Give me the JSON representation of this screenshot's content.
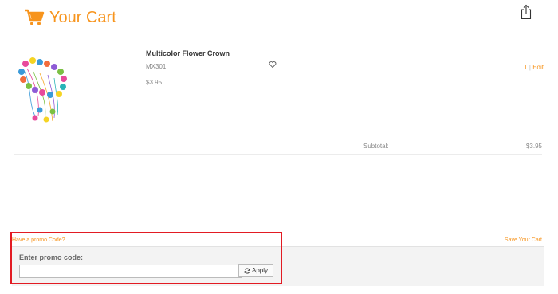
{
  "header": {
    "title": "Your Cart",
    "cart_icon": "shopping-cart-icon",
    "share_icon": "share-icon",
    "accent_color": "#f7941d"
  },
  "cart": {
    "items": [
      {
        "name": "Multicolor Flower Crown",
        "sku": "MX301",
        "price": "$3.95",
        "quantity": "1",
        "edit_label": "Edit",
        "wish_icon": "heart-icon"
      }
    ],
    "subtotal_label": "Subtotal:",
    "subtotal_value": "$3.95"
  },
  "promo": {
    "link_label": "Have a promo Code?",
    "field_label": "Enter promo code:",
    "input_value": "",
    "apply_label": "Apply",
    "apply_icon": "refresh-icon"
  },
  "save_cart_label": "Save Your Cart",
  "highlight_color": "#e21b23"
}
